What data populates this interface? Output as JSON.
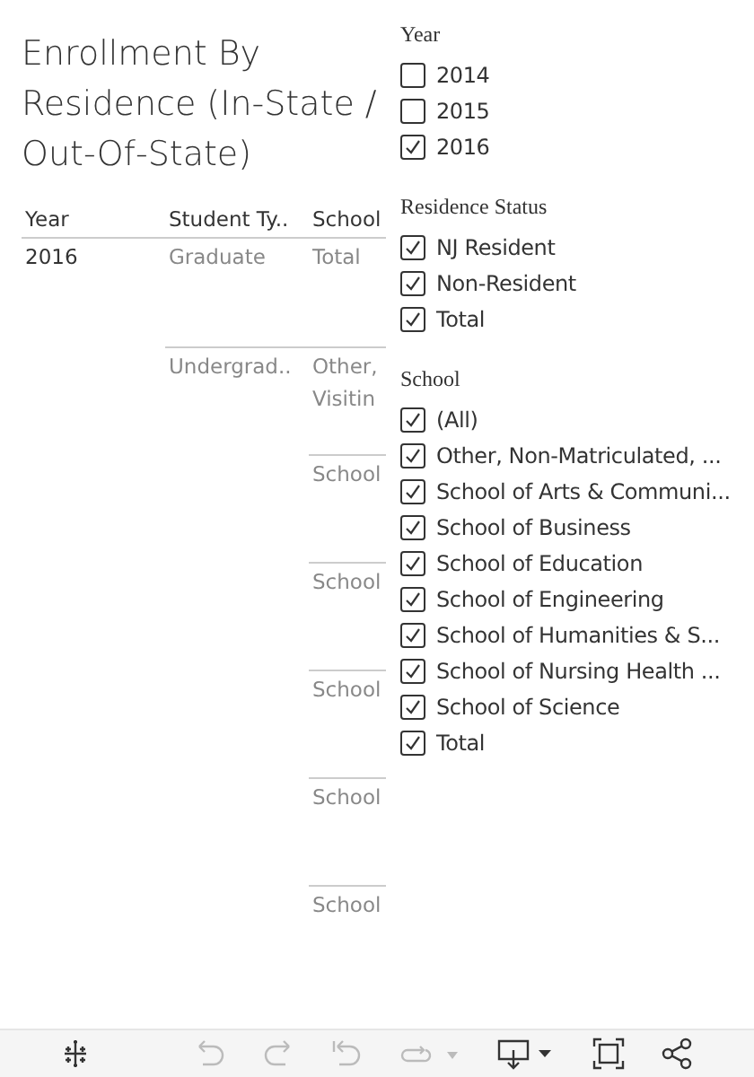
{
  "title": "Enrollment By Residence (In-State / Out-Of-State)",
  "table": {
    "columns": [
      "Year",
      "Student Ty..",
      "School"
    ],
    "year": "2016",
    "groups": [
      {
        "student_type": "Graduate",
        "schools": [
          "Total"
        ]
      },
      {
        "student_type": "Undergrad..",
        "schools": [
          "Other, Visitin",
          "School",
          "School",
          "School",
          "School",
          "School"
        ]
      }
    ]
  },
  "filters": [
    {
      "title": "Year",
      "items": [
        {
          "label": "2014",
          "checked": false
        },
        {
          "label": "2015",
          "checked": false
        },
        {
          "label": "2016",
          "checked": true
        }
      ]
    },
    {
      "title": "Residence Status",
      "items": [
        {
          "label": "NJ Resident",
          "checked": true
        },
        {
          "label": "Non-Resident",
          "checked": true
        },
        {
          "label": "Total",
          "checked": true
        }
      ]
    },
    {
      "title": "School",
      "items": [
        {
          "label": "(All)",
          "checked": true
        },
        {
          "label": "Other, Non-Matriculated, ...",
          "checked": true
        },
        {
          "label": "School of Arts & Communi...",
          "checked": true
        },
        {
          "label": "School of Business",
          "checked": true
        },
        {
          "label": "School of Education",
          "checked": true
        },
        {
          "label": "School of Engineering",
          "checked": true
        },
        {
          "label": "School of Humanities & S...",
          "checked": true
        },
        {
          "label": "School of Nursing Health ...",
          "checked": true
        },
        {
          "label": "School of Science",
          "checked": true
        },
        {
          "label": "Total",
          "checked": true
        }
      ]
    }
  ],
  "toolbar": [
    {
      "kind": "logo",
      "disabled": false
    },
    {
      "kind": "undo",
      "disabled": true
    },
    {
      "kind": "redo",
      "disabled": true
    },
    {
      "kind": "revert",
      "disabled": true
    },
    {
      "kind": "refresh",
      "disabled": true
    },
    {
      "kind": "download",
      "disabled": false
    },
    {
      "kind": "fullscreen",
      "disabled": false
    },
    {
      "kind": "share",
      "disabled": false
    }
  ]
}
